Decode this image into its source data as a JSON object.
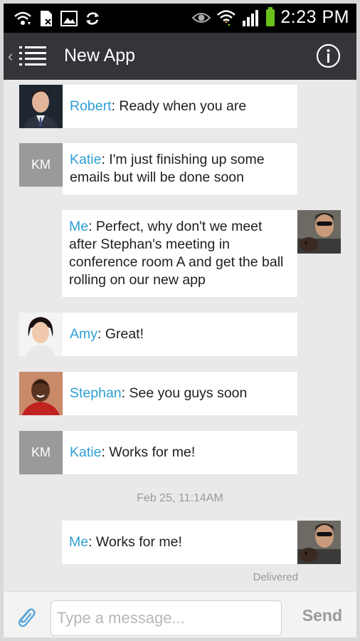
{
  "status_bar": {
    "time": "2:23 PM",
    "icons": [
      "wifi-calling-icon",
      "sim-icon",
      "gallery-icon",
      "sync-icon",
      "eye-icon",
      "wifi-icon",
      "signal-icon",
      "battery-icon"
    ],
    "battery_color": "#69c11a"
  },
  "app_bar": {
    "title": "New App",
    "background": "#333538"
  },
  "colors": {
    "sender": "#2e9fd3",
    "chat_background": "#e9e9e9"
  },
  "messages": [
    {
      "sender": "Robert",
      "text": ": Ready when you are",
      "avatar": "photo-avatar-robert"
    },
    {
      "sender": "Katie",
      "text": ": I'm just finishing up some emails but will be done soon",
      "avatar_initials": "KM"
    },
    {
      "sender": "Me",
      "text": ": Perfect, why don't we meet after Stephan's meeting in conference room A and get the ball rolling on our new app",
      "avatar": "photo-avatar-me"
    },
    {
      "sender": "Amy",
      "text": ": Great!",
      "avatar": "photo-avatar-amy"
    },
    {
      "sender": "Stephan",
      "text": ": See you guys soon",
      "avatar": "photo-avatar-stephan"
    },
    {
      "sender": "Katie",
      "text": ": Works for me!",
      "avatar_initials": "KM"
    },
    {
      "sender": "Me",
      "text": ": Works for me!",
      "avatar": "photo-avatar-me"
    }
  ],
  "timestamp": "Feb 25, 11:14AM",
  "delivered_label": "Delivered",
  "composer": {
    "placeholder": "Type a message...",
    "send_label": "Send"
  }
}
